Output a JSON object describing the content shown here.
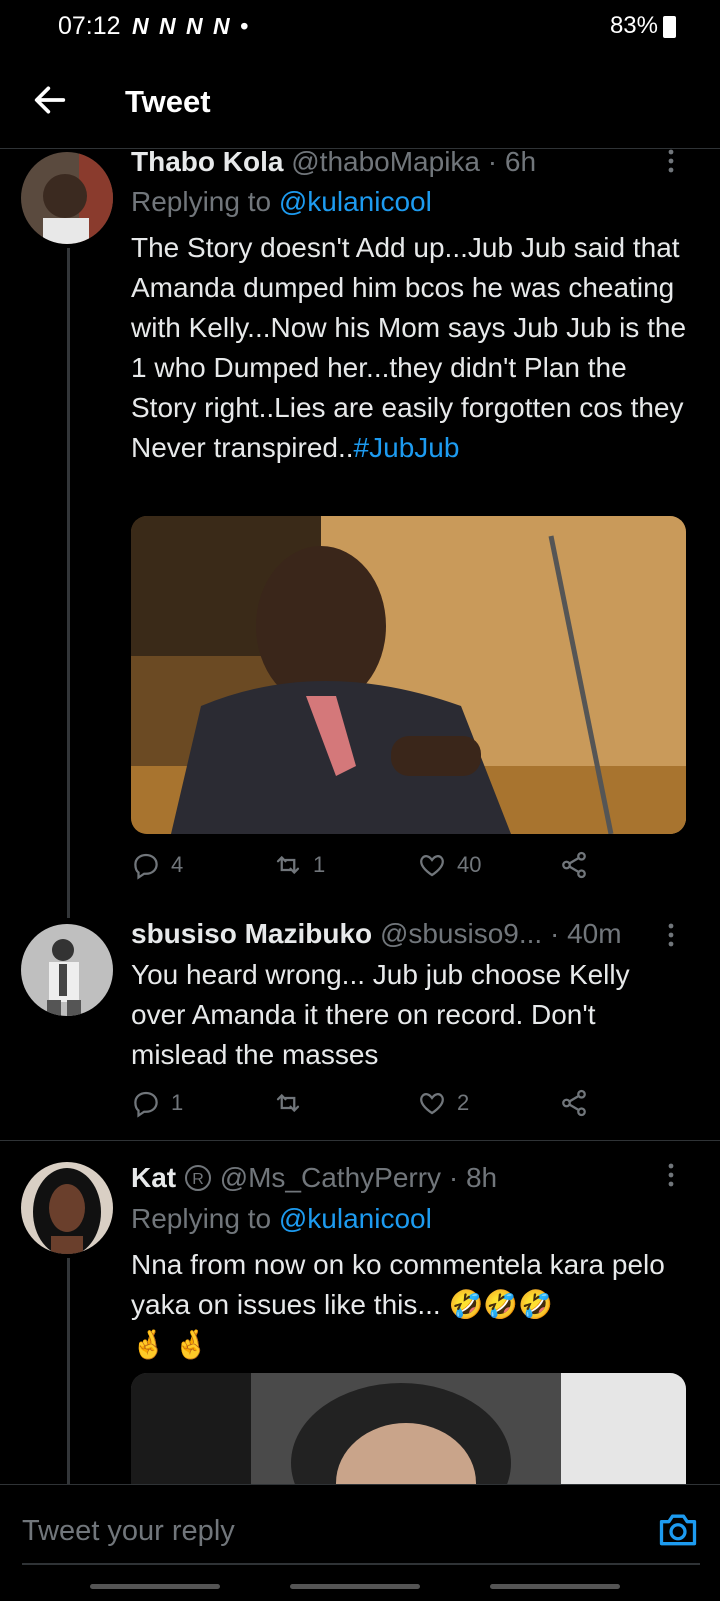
{
  "status_bar": {
    "time": "07:12",
    "notification_icons": "N N N N •",
    "right": "83%"
  },
  "header": {
    "title": "Tweet"
  },
  "tweets": [
    {
      "name": "Thabo Kola",
      "handle": "@thaboMapika",
      "time": "· 6h",
      "replying_prefix": "Replying to ",
      "replying_to": "@kulanicool",
      "text": "The Story doesn't Add up...Jub Jub said that Amanda dumped him bcos he was cheating with Kelly...Now his Mom says Jub Jub is the 1 who Dumped her...they didn't Plan the Story right..Lies are easily forgotten cos they Never transpired..",
      "hashtag": "#JubJub",
      "replies": "4",
      "retweets": "1",
      "likes": "40"
    },
    {
      "name": "sbusiso Mazibuko",
      "handle": "@sbusiso9...",
      "time": "· 40m",
      "text": "You heard wrong... Jub jub choose Kelly over Amanda it there on record. Don't mislead the masses",
      "replies": "1",
      "retweets": "",
      "likes": "2"
    },
    {
      "name": "Kat",
      "handle": "@Ms_CathyPerry",
      "time": "· 8h",
      "replying_prefix": "Replying to ",
      "replying_to": "@kulanicool",
      "text": "Nna from now on ko commentela kara pelo yaka on issues like this... 🤣🤣🤣",
      "text2": "🤞 🤞"
    }
  ],
  "reply_bar": {
    "placeholder": "Tweet your reply"
  },
  "colors": {
    "accent": "#1d9bf0",
    "muted": "#71767b",
    "background": "#000000"
  }
}
